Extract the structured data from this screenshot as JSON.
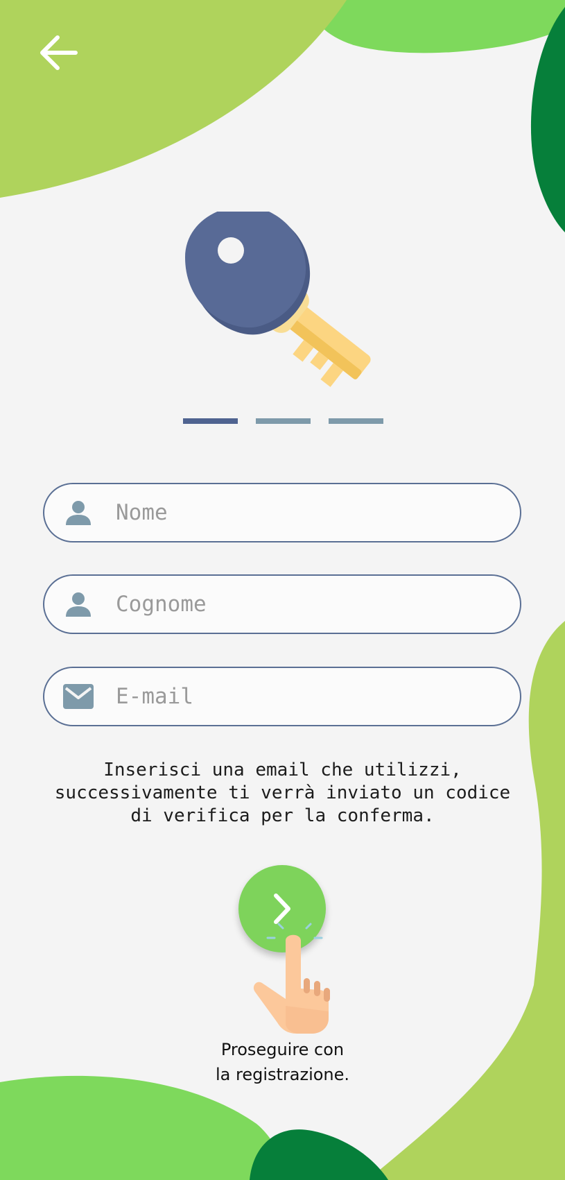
{
  "colors": {
    "background": "#f4f4f4",
    "lime_green": "#afd35c",
    "bright_green": "#7ed95c",
    "dark_green": "#067f3a",
    "key_blue": "#586a96",
    "key_gold": "#fcd581",
    "field_border": "#5a6f94",
    "icon_gray_blue": "#7e9aaa",
    "next_button": "#7ed35b"
  },
  "header": {
    "back_icon": "arrow-left-icon"
  },
  "illustration": {
    "icon": "key-icon"
  },
  "progress": {
    "total_steps": 3,
    "current_step": 1
  },
  "form": {
    "name_field": {
      "icon": "user-icon",
      "placeholder": "Nome",
      "value": ""
    },
    "surname_field": {
      "icon": "user-icon",
      "placeholder": "Cognome",
      "value": ""
    },
    "email_field": {
      "icon": "envelope-icon",
      "placeholder": "E-mail",
      "value": ""
    }
  },
  "info_text": "Inserisci una email che utilizzi,\nsuccessivamente ti verrà inviato un codice\ndi verifica per la conferma.",
  "next_button": {
    "icon": "chevron-right-icon"
  },
  "hint": {
    "icon": "pointing-hand-icon",
    "line1": "Proseguire con",
    "line2": "la registrazione."
  }
}
